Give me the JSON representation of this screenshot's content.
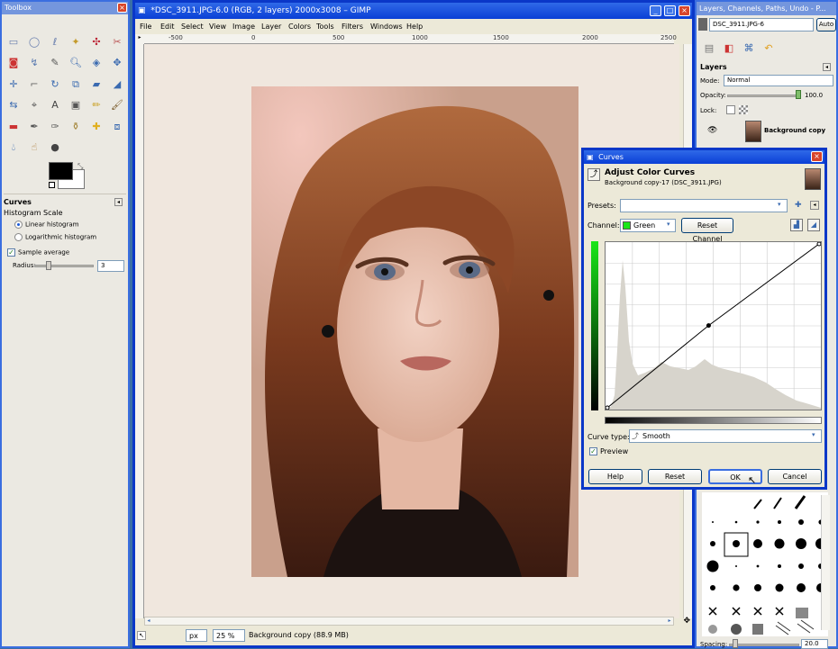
{
  "toolbox": {
    "title": "Toolbox",
    "options_title": "Curves",
    "histogram_scale_label": "Histogram Scale",
    "linear_histogram": "Linear histogram",
    "logarithmic_histogram": "Logarithmic histogram",
    "sample_average_label": "Sample average",
    "radius_label": "Radius:",
    "radius_value": "3"
  },
  "image_window": {
    "title": "*DSC_3911.JPG-6.0 (RGB, 2 layers) 2000x3008 – GIMP",
    "menu": [
      "File",
      "Edit",
      "Select",
      "View",
      "Image",
      "Layer",
      "Colors",
      "Tools",
      "Filters",
      "Windows",
      "Help"
    ],
    "ruler_ticks": [
      "-500",
      "0",
      "500",
      "1000",
      "1500",
      "2000",
      "2500"
    ],
    "status": {
      "unit": "px",
      "zoom": "25 %",
      "layer_info": "Background copy (88.9 MB)"
    }
  },
  "dock": {
    "title": "Layers, Channels, Paths, Undo - P...",
    "image_menu": "DSC_3911.JPG-6",
    "auto_button": "Auto",
    "layers_title": "Layers",
    "mode_label": "Mode:",
    "mode_value": "Normal",
    "opacity_label": "Opacity:",
    "opacity_value": "100.0",
    "lock_label": "Lock:",
    "layer_name": "Background copy",
    "spacing_label": "Spacing:",
    "spacing_value": "20.0"
  },
  "curves_dialog": {
    "title": "Curves",
    "heading": "Adjust Color Curves",
    "subheading": "Background copy-17 (DSC_3911.JPG)",
    "presets_label": "Presets:",
    "presets_value": "",
    "channel_label": "Channel:",
    "channel_value": "Green",
    "reset_channel": "Reset Channel",
    "curve_type_label": "Curve type:",
    "curve_type_value": "Smooth",
    "preview_label": "Preview",
    "help": "Help",
    "reset": "Reset",
    "ok": "OK",
    "cancel": "Cancel",
    "curve_points": [
      [
        0,
        0
      ],
      [
        122,
        128
      ],
      [
        255,
        255
      ]
    ]
  },
  "colors": {
    "titlebar": "#0a3fd6",
    "window_bg": "#ece9d8",
    "canvas_bg": "#f0e7de",
    "channel_green": "#19e619"
  }
}
